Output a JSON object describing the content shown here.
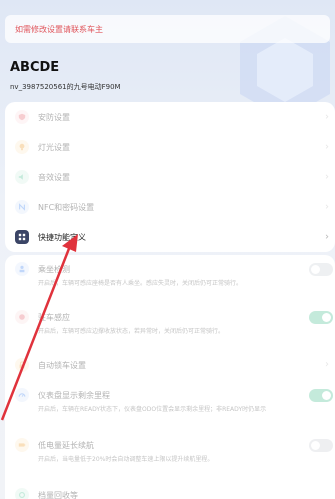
{
  "notice": {
    "text": "如需修改设置请联系车主"
  },
  "vehicle": {
    "name": "ABCDE",
    "id_line": "nv_3987520561的九号电动F90M"
  },
  "menu": [
    {
      "label": "安防设置",
      "icon": "shield-icon",
      "color": "#e8707a"
    },
    {
      "label": "灯光设置",
      "icon": "bulb-icon",
      "color": "#f0a640"
    },
    {
      "label": "音效设置",
      "icon": "speaker-icon",
      "color": "#58c49a"
    },
    {
      "label": "NFC和密码设置",
      "icon": "nfc-icon",
      "color": "#4d8df0"
    },
    {
      "label": "快捷功能定义",
      "icon": "grid-icon",
      "color": "#3b4566"
    }
  ],
  "settings": [
    {
      "label": "乘坐检测",
      "desc": "开启后，车辆可感应座椅是否有人乘坐。感应失灵时，关闭后仍可正常骑行。",
      "toggle": "off",
      "icon": "seat-icon",
      "color": "#4d8df0"
    },
    {
      "label": "驻车感应",
      "desc": "开启后，车辆可感应边撑收放状态，若异常时，关闭后仍可正常骑行。",
      "toggle": "on",
      "icon": "park-icon",
      "color": "#e8707a"
    },
    {
      "label": "自动锁车设置",
      "desc": "",
      "toggle": "none",
      "icon": "lock-icon",
      "color": "#f0a640"
    },
    {
      "label": "仪表盘显示剩余里程",
      "desc": "开启后，车辆在READY状态下，仪表盘ODO位置会显示剩余里程；非READY时仍显示",
      "toggle": "on",
      "icon": "gauge-icon",
      "color": "#4d8df0"
    },
    {
      "label": "低电量延长续航",
      "desc": "开启后，当电量低于20%时会自动调整车速上限以提升续航里程。",
      "toggle": "off",
      "icon": "battery-icon",
      "color": "#f0a640"
    },
    {
      "label": "档量回收等",
      "desc": "",
      "toggle": "none",
      "icon": "recycle-icon",
      "color": "#58c49a"
    }
  ],
  "colors": {
    "accent_red": "#e0555b",
    "toggle_on": "#58c49a",
    "arrow": "#e0323c"
  }
}
